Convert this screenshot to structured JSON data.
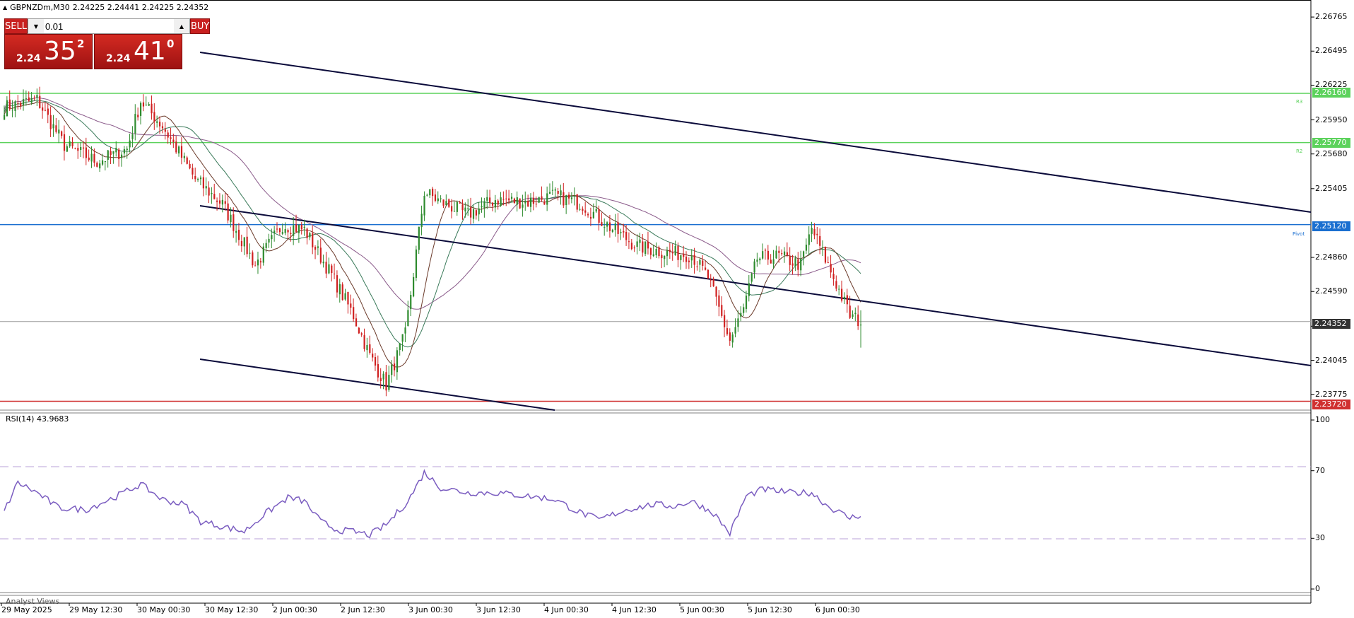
{
  "header": {
    "symbol_text": "GBPNZDm,M30",
    "ohlc_text": "2.24225 2.24441 2.24225 2.24352"
  },
  "trade_panel": {
    "sell_label": "SELL",
    "buy_label": "BUY",
    "lot_value": "0.01",
    "sell_price": {
      "small": "2.24",
      "big": "35",
      "sup": "2"
    },
    "buy_price": {
      "small": "2.24",
      "big": "41",
      "sup": "0"
    }
  },
  "price_axis_ticks": [
    "2.26765",
    "2.26495",
    "2.26225",
    "2.25950",
    "2.25680",
    "2.25405",
    "2.24860",
    "2.24590",
    "2.24315",
    "2.24045",
    "2.23775"
  ],
  "rsi_axis_ticks": [
    "100",
    "70",
    "30",
    "0"
  ],
  "price_tags": {
    "r3": "2.26160",
    "r2": "2.25770",
    "pivot": "2.25120",
    "bid": "2.24352",
    "s": "2.23720"
  },
  "line_labels": {
    "r3": "R3",
    "r2": "R2",
    "pivot": "Pivot"
  },
  "rsi": {
    "label": "RSI(14) 43.9683",
    "levels": [
      70,
      30
    ]
  },
  "analyst_label": "Analyst Views",
  "time_axis": [
    "29 May 2025",
    "29 May 12:30",
    "30 May 00:30",
    "30 May 12:30",
    "2 Jun 00:30",
    "2 Jun 12:30",
    "3 Jun 00:30",
    "3 Jun 12:30",
    "4 Jun 00:30",
    "4 Jun 12:30",
    "5 Jun 00:30",
    "5 Jun 12:30",
    "6 Jun 00:30"
  ],
  "colors": {
    "bull": "#2e8b2e",
    "bear": "#d02020",
    "resistance": "#5cd25c",
    "pivot": "#1a6fd0",
    "support": "#d03030",
    "channel": "#0a0a3a",
    "rsi_line": "#7a5cc0",
    "ma_purple": "#8a5a8a",
    "ma_green": "#3a7a5a",
    "ma_brown": "#6b3a2a"
  },
  "chart_data": {
    "type": "candlestick",
    "symbol": "GBPNZDm",
    "timeframe": "M30",
    "ylim": [
      2.2365,
      2.269
    ],
    "last_ohlc": {
      "open": 2.24225,
      "high": 2.24441,
      "low": 2.24225,
      "close": 2.24352
    },
    "horizontal_levels": [
      {
        "name": "R3",
        "value": 2.2616
      },
      {
        "name": "R2",
        "value": 2.2577
      },
      {
        "name": "Pivot",
        "value": 2.2512
      },
      {
        "name": "bid",
        "value": 2.24352
      },
      {
        "name": "support",
        "value": 2.2372
      }
    ],
    "close_path": [
      [
        0,
        2.2605
      ],
      [
        12,
        2.2611
      ],
      [
        22,
        2.2575
      ],
      [
        34,
        2.2562
      ],
      [
        45,
        2.2572
      ],
      [
        50,
        2.261
      ],
      [
        58,
        2.259
      ],
      [
        70,
        2.2548
      ],
      [
        80,
        2.2528
      ],
      [
        92,
        2.248
      ],
      [
        102,
        2.2512
      ],
      [
        110,
        2.2508
      ],
      [
        120,
        2.2472
      ],
      [
        128,
        2.244
      ],
      [
        134,
        2.2408
      ],
      [
        140,
        2.2385
      ],
      [
        147,
        2.2425
      ],
      [
        154,
        2.2538
      ],
      [
        160,
        2.253
      ],
      [
        170,
        2.252
      ],
      [
        180,
        2.2532
      ],
      [
        192,
        2.253
      ],
      [
        202,
        2.2535
      ],
      [
        212,
        2.2528
      ],
      [
        222,
        2.251
      ],
      [
        232,
        2.2495
      ],
      [
        242,
        2.249
      ],
      [
        252,
        2.2488
      ],
      [
        258,
        2.247
      ],
      [
        266,
        2.242
      ],
      [
        271,
        2.2445
      ],
      [
        276,
        2.2485
      ],
      [
        284,
        2.2487
      ],
      [
        292,
        2.248
      ],
      [
        296,
        2.2509
      ],
      [
        304,
        2.247
      ],
      [
        310,
        2.244
      ],
      [
        314,
        2.2435
      ]
    ],
    "rsi_path": [
      [
        0,
        46
      ],
      [
        5,
        63
      ],
      [
        12,
        57
      ],
      [
        20,
        48
      ],
      [
        30,
        47
      ],
      [
        40,
        54
      ],
      [
        50,
        62
      ],
      [
        58,
        53
      ],
      [
        66,
        50
      ],
      [
        72,
        40
      ],
      [
        80,
        37
      ],
      [
        88,
        34
      ],
      [
        96,
        45
      ],
      [
        104,
        54
      ],
      [
        110,
        52
      ],
      [
        116,
        40
      ],
      [
        122,
        35
      ],
      [
        128,
        34
      ],
      [
        134,
        32
      ],
      [
        140,
        38
      ],
      [
        148,
        52
      ],
      [
        154,
        69
      ],
      [
        160,
        60
      ],
      [
        170,
        57
      ],
      [
        180,
        57
      ],
      [
        192,
        55
      ],
      [
        202,
        53
      ],
      [
        210,
        46
      ],
      [
        218,
        41
      ],
      [
        228,
        47
      ],
      [
        238,
        50
      ],
      [
        246,
        49
      ],
      [
        252,
        52
      ],
      [
        260,
        45
      ],
      [
        266,
        33
      ],
      [
        272,
        55
      ],
      [
        278,
        59
      ],
      [
        288,
        57
      ],
      [
        296,
        57
      ],
      [
        302,
        49
      ],
      [
        310,
        42
      ],
      [
        314,
        44
      ]
    ],
    "rsi_value": 43.9683,
    "rsi_levels": [
      70,
      30
    ],
    "rsi_ylim": [
      0,
      100
    ]
  }
}
